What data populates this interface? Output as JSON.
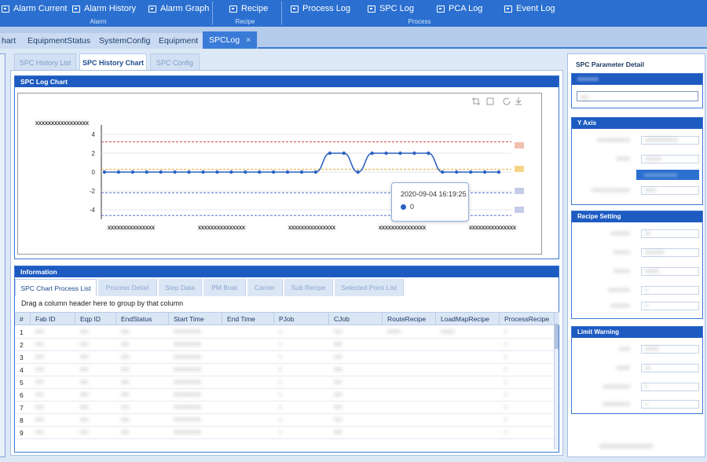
{
  "ribbon": {
    "buttons": [
      {
        "label": "Alarm Current",
        "icon": "bell-icon"
      },
      {
        "label": "Alarm History",
        "icon": "history-icon"
      },
      {
        "label": "Alarm Graph",
        "icon": "graph-icon"
      },
      {
        "label": "Recipe",
        "icon": "recipe-icon"
      },
      {
        "label": "Process Log",
        "icon": "log-icon"
      },
      {
        "label": "SPC Log",
        "icon": "spc-icon"
      },
      {
        "label": "PCA Log",
        "icon": "pca-icon"
      },
      {
        "label": "Event Log",
        "icon": "event-icon"
      }
    ],
    "groups": [
      "Alarm",
      "Recipe",
      "Process"
    ]
  },
  "tabs": [
    "hart",
    "EquipmentStatus",
    "SystemConfig",
    "Equipment",
    "SPCLog"
  ],
  "active_tab_close": "×",
  "subtabs": [
    "SPC History List",
    "SPC History Chart",
    "SPC Config"
  ],
  "chart_panel": {
    "title": "SPC Log Chart",
    "icons": [
      "crop-icon",
      "square-icon",
      "refresh-icon",
      "download-icon"
    ]
  },
  "chart_data": {
    "type": "line",
    "yticks": [
      4,
      2,
      0,
      -2,
      -4
    ],
    "ylim": [
      -5,
      5
    ],
    "x_blurred": [
      "xxxxxxxxxxxxxxx",
      "xxxxxxxxxxxxxxx",
      "xxxxxxxxxxxxxxx",
      "xxxxxxxxxxxxxxx",
      "xxxxxxxxxxxxxxx"
    ],
    "series": [
      {
        "values": [
          0,
          0,
          0,
          0,
          0,
          0,
          0,
          0,
          0,
          0,
          0,
          0,
          0,
          0,
          0,
          0,
          2,
          2,
          0,
          2,
          2,
          2,
          2,
          2,
          0,
          0,
          0,
          0,
          0
        ]
      }
    ],
    "hlines": [
      {
        "y": 3.2,
        "color": "#d04040"
      },
      {
        "y": 0.3,
        "color": "#e0b040"
      },
      {
        "y": -2.2,
        "color": "#5a6fd0"
      },
      {
        "y": -4.6,
        "color": "#5a6fd0"
      }
    ],
    "tooltip": {
      "time": "2020-09-04 16:19:25",
      "value": "0"
    }
  },
  "info_panel": {
    "title": "Information"
  },
  "process_tabs": [
    "SPC Chart Process List",
    "Process Detail",
    "Step Data",
    "PM Boat",
    "Carrier",
    "Sub Recipe",
    "Selected Point List"
  ],
  "drag_hint": "Drag a column header here to group by that column",
  "grid": {
    "columns": [
      "#",
      "Fab ID",
      "Eqp ID",
      "EndStatus",
      "Start Time",
      "End Time",
      "PJob",
      "CJob",
      "RouteRecipe",
      "LoadMapRecipe",
      "ProcessRecipe"
    ],
    "rows": [
      "1",
      "2",
      "3",
      "4",
      "5",
      "6",
      "7",
      "8",
      "9"
    ]
  },
  "right": {
    "title": "SPC Parameter Detail",
    "yaxis_title": "Y Axis",
    "recipe_title": "Recipe Setting",
    "limit_title": "Limit Warning"
  }
}
